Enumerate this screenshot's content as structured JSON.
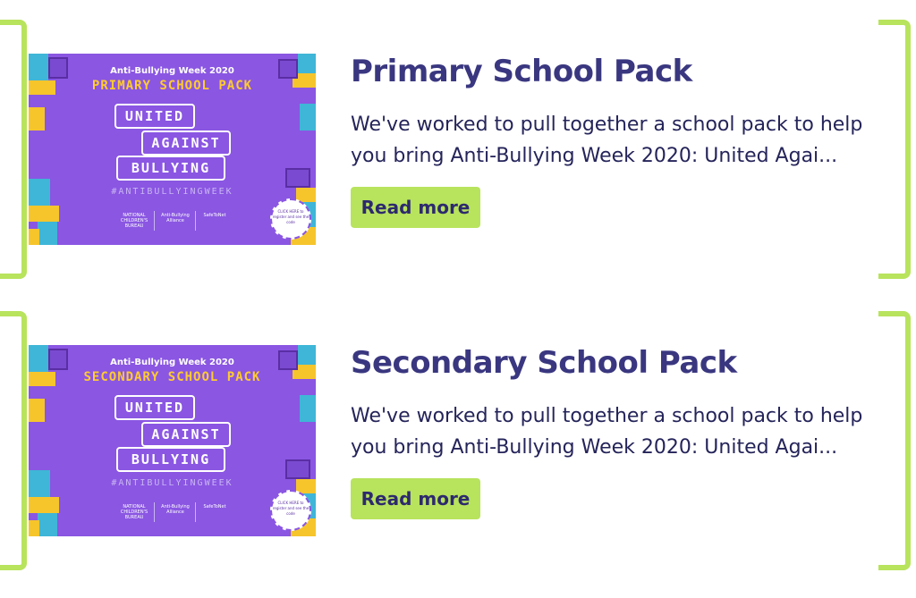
{
  "colors": {
    "accent_green": "#b8e35d",
    "title_navy": "#3a3780",
    "poster_purple": "#8a56e2",
    "poster_yellow": "#ffcb2f",
    "poster_teal": "#3fb6d7"
  },
  "cards": [
    {
      "poster": {
        "pre_title": "Anti-Bullying Week 2020",
        "pack_title": "PRIMARY SCHOOL PACK",
        "words": [
          "UNITED",
          "AGAINST",
          "BULLYING"
        ],
        "hashtag": "#ANTIBULLYINGWEEK",
        "logos": [
          "NATIONAL CHILDREN'S BUREAU",
          "Anti-Bullying Alliance",
          "SafeToNet"
        ],
        "stamp": "CLICK HERE to register and see the code"
      },
      "title": "Primary School Pack",
      "description": "We've worked to pull together a school pack to help you bring Anti-Bullying Week 2020: United Agai...",
      "button_label": "Read more"
    },
    {
      "poster": {
        "pre_title": "Anti-Bullying Week 2020",
        "pack_title": "SECONDARY SCHOOL PACK",
        "words": [
          "UNITED",
          "AGAINST",
          "BULLYING"
        ],
        "hashtag": "#ANTIBULLYINGWEEK",
        "logos": [
          "NATIONAL CHILDREN'S BUREAU",
          "Anti-Bullying Alliance",
          "SafeToNet"
        ],
        "stamp": "CLICK HERE to register and see the code"
      },
      "title": "Secondary School Pack",
      "description": "We've worked to pull together a school pack to help you bring Anti-Bullying Week 2020: United Agai...",
      "button_label": "Read more"
    }
  ]
}
